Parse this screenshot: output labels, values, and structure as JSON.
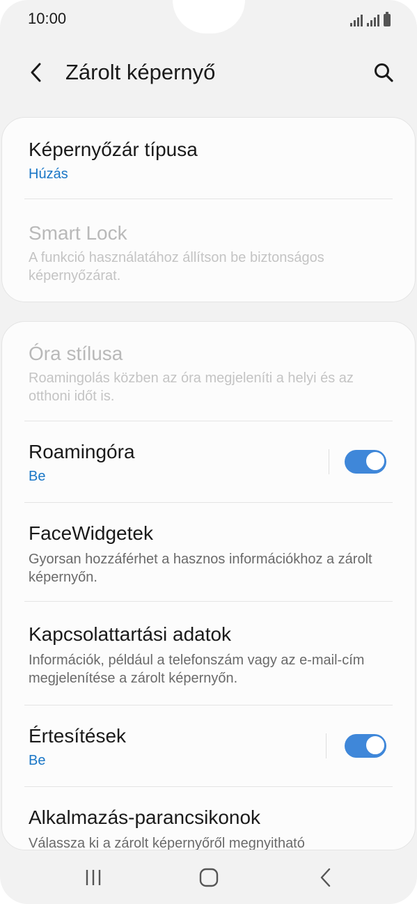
{
  "status_bar": {
    "time": "10:00"
  },
  "header": {
    "title": "Zárolt képernyő"
  },
  "sections": {
    "lock_type": {
      "title": "Képernyőzár típusa",
      "value": "Húzás"
    },
    "smart_lock": {
      "title": "Smart Lock",
      "subtitle": "A funkció használatához állítson be biztonságos képernyőzárat."
    },
    "clock_style": {
      "title": "Óra stílusa",
      "subtitle": "Roamingolás közben az óra megjeleníti a helyi és az otthoni időt is."
    },
    "roaming_clock": {
      "title": "Roamingóra",
      "value": "Be",
      "enabled": true
    },
    "face_widgets": {
      "title": "FaceWidgetek",
      "subtitle": "Gyorsan hozzáférhet a hasznos információkhoz a zárolt képernyőn."
    },
    "contact_info": {
      "title": "Kapcsolattartási adatok",
      "subtitle": "Információk, például a telefonszám vagy az e-mail-cím megjelenítése a zárolt képernyőn."
    },
    "notifications": {
      "title": "Értesítések",
      "value": "Be",
      "enabled": true
    },
    "app_shortcuts": {
      "title": "Alkalmazás-parancsikonok",
      "subtitle": "Válassza ki a zárolt képernyőről megnyitható"
    }
  },
  "colors": {
    "accent": "#1976c6",
    "toggle_on": "#3f87d9",
    "background": "#f2f2f2",
    "card": "#fcfcfc"
  },
  "icons": {
    "back": "chevron-left-icon",
    "search": "search-icon",
    "recents": "recents-icon",
    "home": "home-icon",
    "nav_back": "nav-back-icon"
  }
}
